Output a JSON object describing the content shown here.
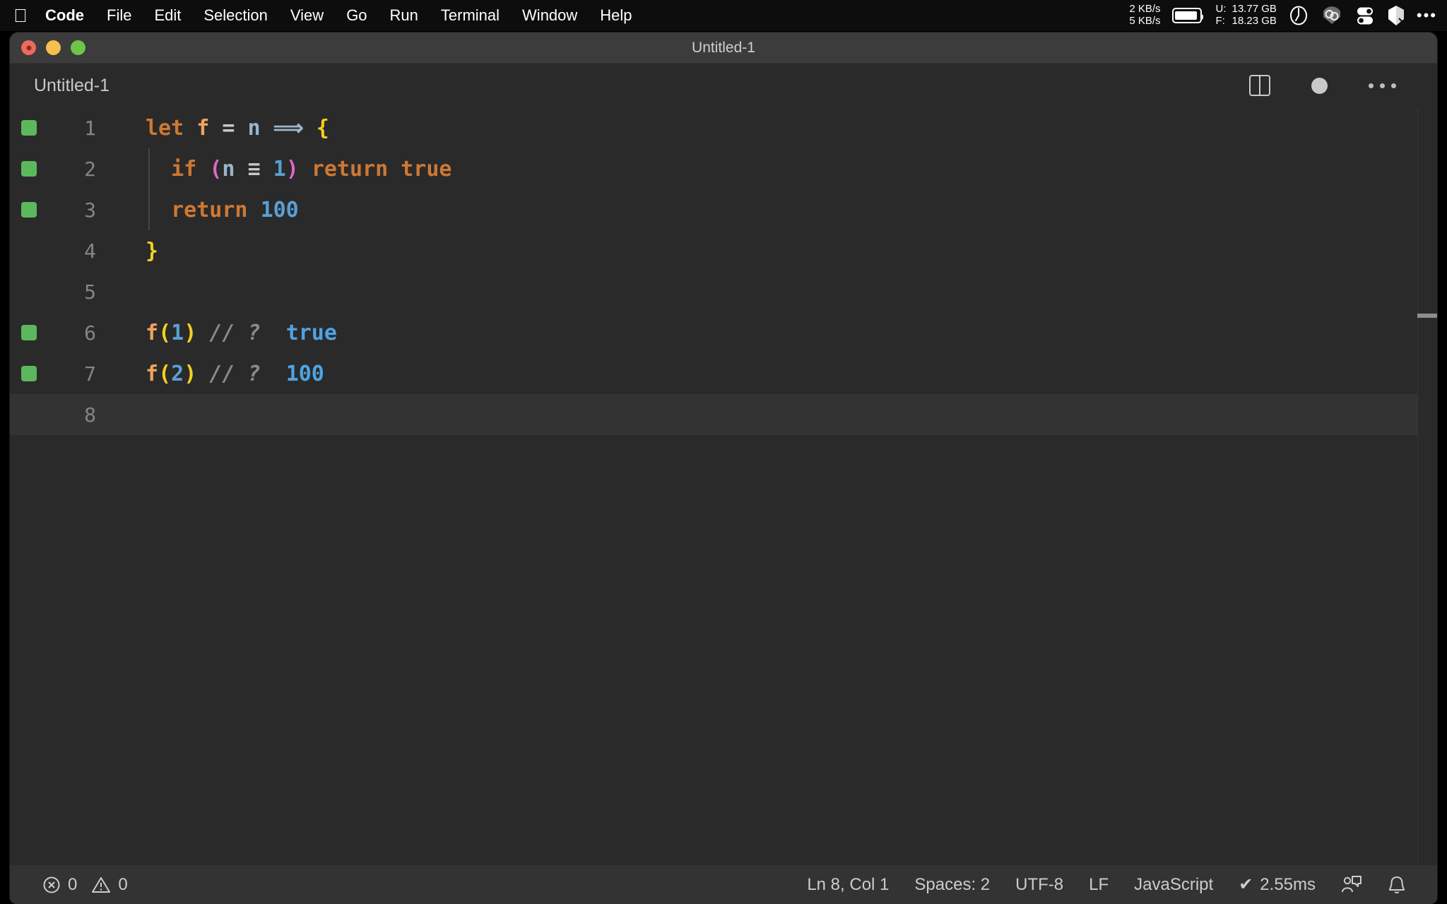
{
  "menubar": {
    "apple_icon": "apple-logo-icon",
    "items": [
      {
        "label": "Code",
        "bold": true
      },
      {
        "label": "File",
        "bold": false
      },
      {
        "label": "Edit",
        "bold": false
      },
      {
        "label": "Selection",
        "bold": false
      },
      {
        "label": "View",
        "bold": false
      },
      {
        "label": "Go",
        "bold": false
      },
      {
        "label": "Run",
        "bold": false
      },
      {
        "label": "Terminal",
        "bold": false
      },
      {
        "label": "Window",
        "bold": false
      },
      {
        "label": "Help",
        "bold": false
      }
    ],
    "network": {
      "upload": "2 KB/s",
      "download": "5 KB/s"
    },
    "battery_icon": "battery-full-icon",
    "memory": {
      "used_key": "U:",
      "used_value": "13.77 GB",
      "free_key": "F:",
      "free_value": "18.23 GB"
    },
    "status_icons": [
      "clock-icon",
      "cloud-sync-icon",
      "toggles-icon",
      "shield-icon"
    ],
    "overflow": "•••"
  },
  "window": {
    "title": "Untitled-1",
    "traffic_lights": [
      "close-button",
      "minimize-button",
      "maximize-button"
    ]
  },
  "tabbar": {
    "active_tab": "Untitled-1",
    "actions": [
      {
        "name": "split-editor-icon"
      },
      {
        "name": "unsaved-dot-icon"
      },
      {
        "name": "more-actions-icon"
      }
    ]
  },
  "editor": {
    "language": "JavaScript",
    "lines": [
      {
        "number": "1",
        "gutter": true,
        "active": false,
        "indent": false,
        "tokens": [
          {
            "text": "let",
            "cls": "t-kw"
          },
          {
            "text": " ",
            "cls": "t-op"
          },
          {
            "text": "f",
            "cls": "t-fn"
          },
          {
            "text": " ",
            "cls": "t-op"
          },
          {
            "text": "=",
            "cls": "t-op"
          },
          {
            "text": " ",
            "cls": "t-op"
          },
          {
            "text": "n",
            "cls": "t-var"
          },
          {
            "text": " ",
            "cls": "t-op"
          },
          {
            "text": "⟹",
            "cls": "t-arrow"
          },
          {
            "text": " ",
            "cls": "t-op"
          },
          {
            "text": "{",
            "cls": "t-brace"
          }
        ]
      },
      {
        "number": "2",
        "gutter": true,
        "active": false,
        "indent": true,
        "tokens": [
          {
            "text": "  ",
            "cls": "t-op"
          },
          {
            "text": "if",
            "cls": "t-kw"
          },
          {
            "text": " ",
            "cls": "t-op"
          },
          {
            "text": "(",
            "cls": "t-paren"
          },
          {
            "text": "n",
            "cls": "t-var"
          },
          {
            "text": " ",
            "cls": "t-op"
          },
          {
            "text": "≡",
            "cls": "t-op"
          },
          {
            "text": " ",
            "cls": "t-op"
          },
          {
            "text": "1",
            "cls": "t-num"
          },
          {
            "text": ")",
            "cls": "t-paren"
          },
          {
            "text": " ",
            "cls": "t-op"
          },
          {
            "text": "return",
            "cls": "t-kw"
          },
          {
            "text": " ",
            "cls": "t-op"
          },
          {
            "text": "true",
            "cls": "t-kw"
          }
        ]
      },
      {
        "number": "3",
        "gutter": true,
        "active": false,
        "indent": true,
        "tokens": [
          {
            "text": "  ",
            "cls": "t-op"
          },
          {
            "text": "return",
            "cls": "t-kw"
          },
          {
            "text": " ",
            "cls": "t-op"
          },
          {
            "text": "100",
            "cls": "t-num"
          }
        ]
      },
      {
        "number": "4",
        "gutter": false,
        "active": false,
        "indent": false,
        "tokens": [
          {
            "text": "}",
            "cls": "t-brace"
          }
        ]
      },
      {
        "number": "5",
        "gutter": false,
        "active": false,
        "indent": false,
        "tokens": []
      },
      {
        "number": "6",
        "gutter": true,
        "active": false,
        "indent": false,
        "tokens": [
          {
            "text": "f",
            "cls": "t-fn"
          },
          {
            "text": "(",
            "cls": "t-paren2"
          },
          {
            "text": "1",
            "cls": "t-num"
          },
          {
            "text": ")",
            "cls": "t-paren2"
          },
          {
            "text": " ",
            "cls": "t-op"
          },
          {
            "text": "// ?",
            "cls": "t-cmt"
          },
          {
            "text": "  ",
            "cls": "t-op"
          },
          {
            "text": "true",
            "cls": "t-res"
          }
        ]
      },
      {
        "number": "7",
        "gutter": true,
        "active": false,
        "indent": false,
        "tokens": [
          {
            "text": "f",
            "cls": "t-fn"
          },
          {
            "text": "(",
            "cls": "t-paren2"
          },
          {
            "text": "2",
            "cls": "t-num"
          },
          {
            "text": ")",
            "cls": "t-paren2"
          },
          {
            "text": " ",
            "cls": "t-op"
          },
          {
            "text": "// ?",
            "cls": "t-cmt"
          },
          {
            "text": "  ",
            "cls": "t-op"
          },
          {
            "text": "100",
            "cls": "t-res"
          }
        ]
      },
      {
        "number": "8",
        "gutter": false,
        "active": true,
        "indent": false,
        "tokens": []
      }
    ]
  },
  "statusbar": {
    "errors_icon": "error-circle-icon",
    "errors": "0",
    "warnings_icon": "warning-triangle-icon",
    "warnings": "0",
    "cursor_position": "Ln 8, Col 1",
    "indentation": "Spaces: 2",
    "encoding": "UTF-8",
    "eol": "LF",
    "language": "JavaScript",
    "quokka_check": "✔",
    "quokka_time": "2.55ms",
    "feedback_icon": "feedback-person-icon",
    "notifications_icon": "bell-icon"
  },
  "colors": {
    "accent_green": "#5cb85c",
    "keyword_orange": "#ce7833",
    "number_blue": "#5a9fd4",
    "brace_yellow": "#f2d024",
    "paren_magenta": "#e066c8",
    "result_blue": "#4fa3e3",
    "editor_bg": "#2a2a2a",
    "statusbar_bg": "#333333",
    "titlebar_bg": "#3c3c3c"
  }
}
